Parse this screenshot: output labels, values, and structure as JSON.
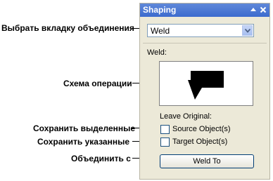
{
  "annotations": {
    "select_tab": "Выбрать вкладку объединения",
    "operation_scheme": "Схема операции",
    "keep_selected": "Сохранить выделенные",
    "keep_target": "Сохранить указанные",
    "weld_with": "Объединить с"
  },
  "panel": {
    "title": "Shaping",
    "title_buttons": [
      "pin-icon",
      "close-icon"
    ],
    "operation_dropdown_value": "Weld",
    "section_label": "Weld:",
    "leave_original_label": "Leave Original:",
    "source_object_label": "Source Object(s)",
    "target_object_label": "Target Object(s)",
    "source_checked": false,
    "target_checked": false,
    "apply_button_label": "Weld To"
  },
  "colors": {
    "titlebar": "#3c6bce",
    "panel_bg": "#ece9d8"
  }
}
